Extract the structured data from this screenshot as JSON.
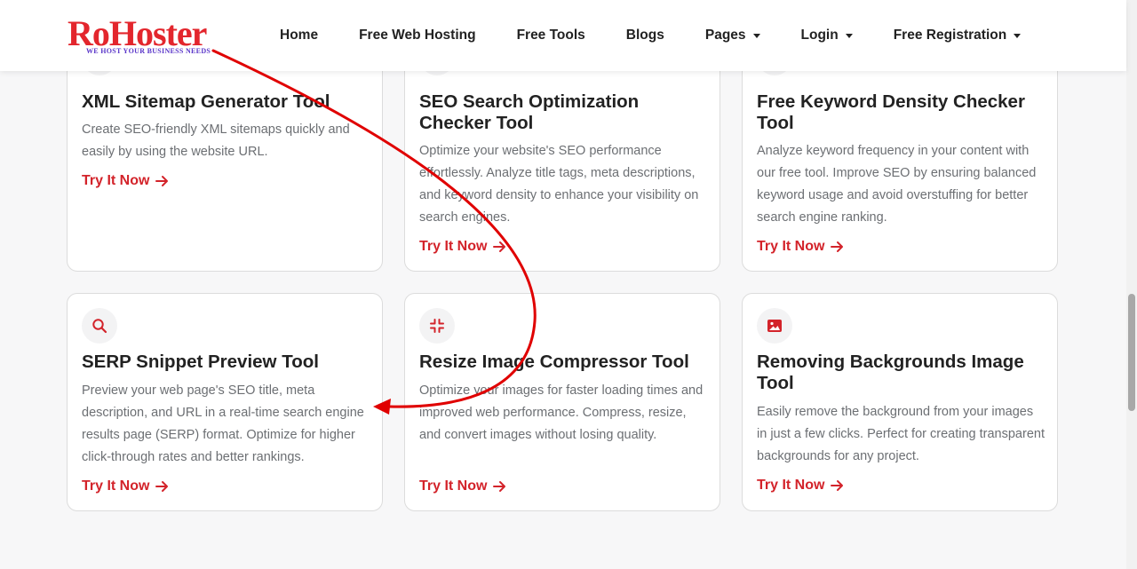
{
  "brand": {
    "name": "RoHoster",
    "tagline": "WE HOST YOUR BUSINESS NEEDS"
  },
  "nav": {
    "items": [
      {
        "label": "Home",
        "dropdown": false
      },
      {
        "label": "Free Web Hosting",
        "dropdown": false
      },
      {
        "label": "Free Tools",
        "dropdown": false
      },
      {
        "label": "Blogs",
        "dropdown": false
      },
      {
        "label": "Pages",
        "dropdown": true
      },
      {
        "label": "Login",
        "dropdown": true
      },
      {
        "label": "Free Registration",
        "dropdown": true
      }
    ]
  },
  "cards": [
    {
      "title": "XML Sitemap Generator Tool",
      "desc": "Create SEO-friendly XML sitemaps quickly and easily by using the website URL.",
      "link": "Try It Now",
      "icon": "sitemap-icon"
    },
    {
      "title": "SEO Search Optimization Checker Tool",
      "desc": "Optimize your website's SEO performance effortlessly. Analyze title tags, meta descriptions, and keyword density to enhance your visibility on search engines.",
      "link": "Try It Now",
      "icon": "seo-icon"
    },
    {
      "title": "Free Keyword Density Checker Tool",
      "desc": "Analyze keyword frequency in your content with our free tool. Improve SEO by ensuring balanced keyword usage and avoid overstuffing for better search engine ranking.",
      "link": "Try It Now",
      "icon": "keyword-icon"
    },
    {
      "title": "SERP Snippet Preview Tool",
      "desc": "Preview your web page's SEO title, meta description, and URL in a real-time search engine results page (SERP) format. Optimize for higher click-through rates and better rankings.",
      "link": "Try It Now",
      "icon": "search-icon"
    },
    {
      "title": "Resize Image Compressor Tool",
      "desc": "Optimize your images for faster loading times and improved web performance. Compress, resize, and convert images without losing quality.",
      "link": "Try It Now",
      "icon": "compress-icon"
    },
    {
      "title": "Removing Backgrounds Image Tool",
      "desc": "Easily remove the background from your images in just a few clicks. Perfect for creating transparent backgrounds for any project.",
      "link": "Try It Now",
      "icon": "image-icon"
    }
  ],
  "colors": {
    "accent": "#d3232a",
    "brand_red": "#e3262d",
    "annotation": "#e00000"
  }
}
